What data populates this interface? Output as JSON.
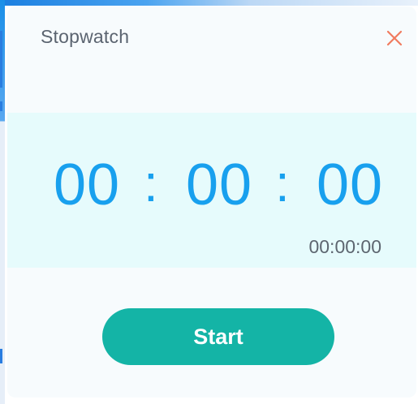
{
  "window": {
    "title": "Stopwatch",
    "close_icon": "close-x-icon"
  },
  "timer": {
    "hours": "00",
    "minutes": "00",
    "seconds": "00",
    "separator": ":",
    "full_time": "00:00:00"
  },
  "actions": {
    "start_label": "Start"
  },
  "colors": {
    "accent_blue": "#18a0ee",
    "panel_bg": "#e6fbfc",
    "button_teal": "#14b4a6",
    "close_red": "#f07b5f"
  }
}
